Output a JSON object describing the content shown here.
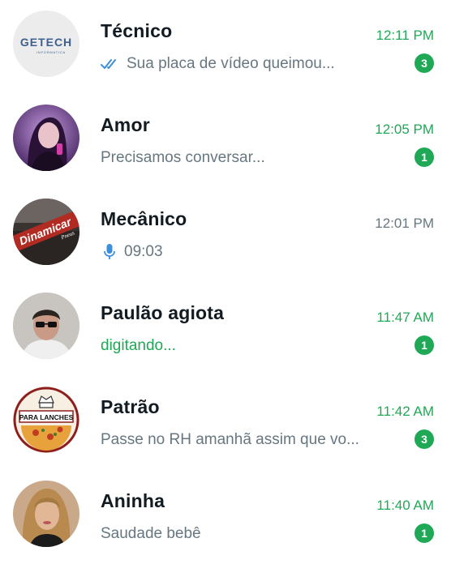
{
  "chats": [
    {
      "name": "Técnico",
      "time": "12:11 PM",
      "preview": "Sua placa de vídeo queimou...",
      "unread": "3",
      "status_icon": "double-check-icon",
      "avatar": {
        "type": "logo",
        "text": "GETECH",
        "subtext": "INFORMATICA"
      }
    },
    {
      "name": "Amor",
      "time": "12:05 PM",
      "preview": "Precisamos conversar...",
      "unread": "1",
      "avatar": {
        "type": "photo",
        "subject": "woman-purple-hair"
      }
    },
    {
      "name": "Mecânico",
      "time": "12:01 PM",
      "preview": "09:03",
      "status_icon": "microphone-icon",
      "avatar": {
        "type": "photo",
        "text": "Dinamicar",
        "subtext": "Pneus"
      }
    },
    {
      "name": "Paulão agiota",
      "time": "11:47 AM",
      "preview": "digitando...",
      "unread": "1",
      "avatar": {
        "type": "photo",
        "subject": "man-sunglasses"
      }
    },
    {
      "name": "Patrão",
      "time": "11:42 AM",
      "preview": "Passe no RH amanhã assim que vo...",
      "unread": "3",
      "avatar": {
        "type": "logo",
        "text": "PARA LANCHES"
      }
    },
    {
      "name": "Aninha",
      "time": "11:40 AM",
      "preview": "Saudade bebê",
      "unread": "1",
      "avatar": {
        "type": "photo",
        "subject": "woman-blonde"
      }
    }
  ],
  "colors": {
    "accent": "#1fa855",
    "tick": "#3c8fd8",
    "name": "#111b21",
    "secondary": "#667781"
  }
}
